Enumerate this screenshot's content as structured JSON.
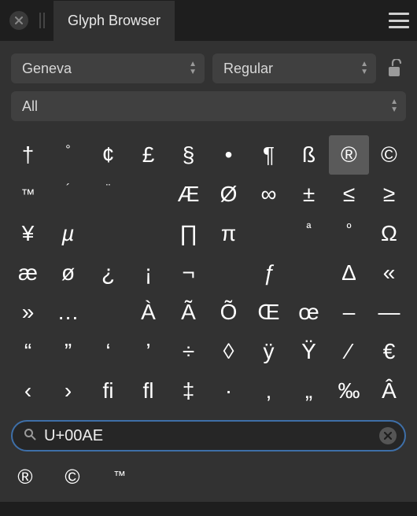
{
  "window": {
    "title": "Glyph Browser"
  },
  "toolbar": {
    "font": "Geneva",
    "style": "Regular",
    "filter": "All",
    "locked": false
  },
  "glyphs": [
    {
      "char": "†"
    },
    {
      "char": "°",
      "sup": true
    },
    {
      "char": "¢"
    },
    {
      "char": "£"
    },
    {
      "char": "§"
    },
    {
      "char": "•"
    },
    {
      "char": "¶"
    },
    {
      "char": "ß"
    },
    {
      "char": "®",
      "selected": true
    },
    {
      "char": "©"
    },
    {
      "char": "™",
      "small": true
    },
    {
      "char": "´",
      "sup": true
    },
    {
      "char": "¨",
      "sup": true
    },
    {
      "char": ""
    },
    {
      "char": "Æ"
    },
    {
      "char": "Ø"
    },
    {
      "char": "∞"
    },
    {
      "char": "±"
    },
    {
      "char": "≤"
    },
    {
      "char": "≥"
    },
    {
      "char": "¥"
    },
    {
      "char": "µ",
      "italic": true
    },
    {
      "char": ""
    },
    {
      "char": ""
    },
    {
      "char": "∏"
    },
    {
      "char": "π"
    },
    {
      "char": ""
    },
    {
      "char": "ª",
      "sup": true
    },
    {
      "char": "º",
      "sup": true
    },
    {
      "char": "Ω"
    },
    {
      "char": "æ"
    },
    {
      "char": "ø"
    },
    {
      "char": "¿"
    },
    {
      "char": "¡"
    },
    {
      "char": "¬"
    },
    {
      "char": ""
    },
    {
      "char": "ƒ",
      "italic": true
    },
    {
      "char": ""
    },
    {
      "char": "Δ"
    },
    {
      "char": "«"
    },
    {
      "char": "»"
    },
    {
      "char": "…"
    },
    {
      "char": ""
    },
    {
      "char": "À"
    },
    {
      "char": "Ã"
    },
    {
      "char": "Õ"
    },
    {
      "char": "Œ"
    },
    {
      "char": "œ"
    },
    {
      "char": "–"
    },
    {
      "char": "—"
    },
    {
      "char": "“"
    },
    {
      "char": "”"
    },
    {
      "char": "‘"
    },
    {
      "char": "’"
    },
    {
      "char": "÷"
    },
    {
      "char": "◊"
    },
    {
      "char": "ÿ"
    },
    {
      "char": "Ÿ"
    },
    {
      "char": "⁄"
    },
    {
      "char": "€"
    },
    {
      "char": "‹"
    },
    {
      "char": "›"
    },
    {
      "char": "ﬁ"
    },
    {
      "char": "ﬂ"
    },
    {
      "char": "‡"
    },
    {
      "char": "·"
    },
    {
      "char": "‚"
    },
    {
      "char": "„"
    },
    {
      "char": "‰"
    },
    {
      "char": "Â"
    }
  ],
  "search": {
    "value": "U+00AE",
    "placeholder": ""
  },
  "results": [
    {
      "char": "®"
    },
    {
      "char": "©"
    },
    {
      "char": "™",
      "small": true
    }
  ]
}
